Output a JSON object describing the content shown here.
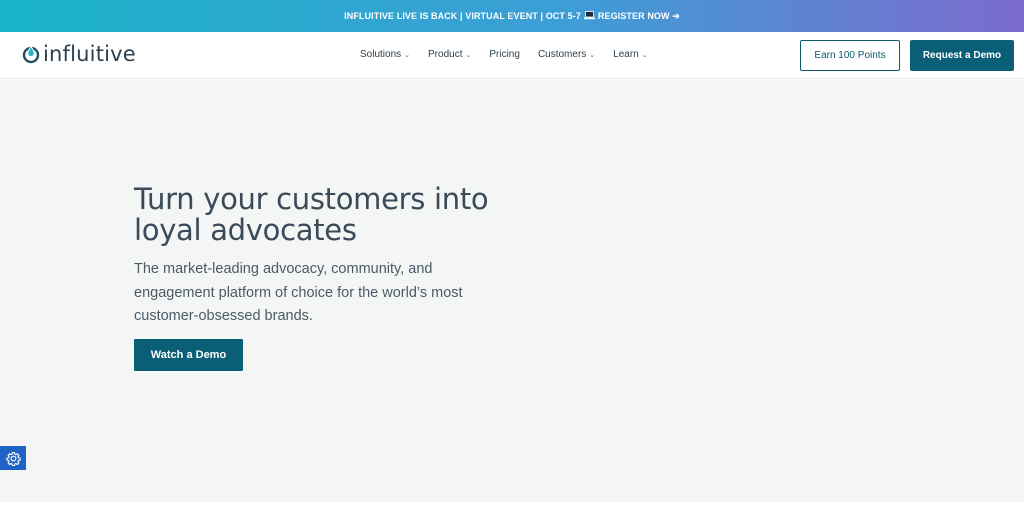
{
  "banner": {
    "text_before": "INFLUITIVE LIVE IS BACK | VIRTUAL EVENT | OCT 5-7",
    "text_after": "REGISTER NOW ➔"
  },
  "logo": {
    "text": "influitive"
  },
  "nav": {
    "items": [
      {
        "label": "Solutions",
        "has_dropdown": true
      },
      {
        "label": "Product",
        "has_dropdown": true
      },
      {
        "label": "Pricing",
        "has_dropdown": false
      },
      {
        "label": "Customers",
        "has_dropdown": true
      },
      {
        "label": "Learn",
        "has_dropdown": true
      }
    ],
    "caret": "⌄",
    "earn_points": "Earn 100 Points",
    "request_demo": "Request a Demo"
  },
  "hero": {
    "title": "Turn your customers into loyal advocates",
    "subtitle": "The market-leading advocacy, community, and engagement platform of choice for the world’s most customer-obsessed brands.",
    "cta": "Watch a Demo"
  },
  "colors": {
    "brand_teal": "#0a5f77",
    "hero_bg": "#f4f6f6",
    "banner_start": "#19b3c8",
    "banner_end": "#7c6bcd",
    "settings_blue": "#1f63c6"
  },
  "icons": {
    "laptop": "laptop-icon",
    "settings": "gear-icon",
    "logo": "drop-power-icon"
  }
}
